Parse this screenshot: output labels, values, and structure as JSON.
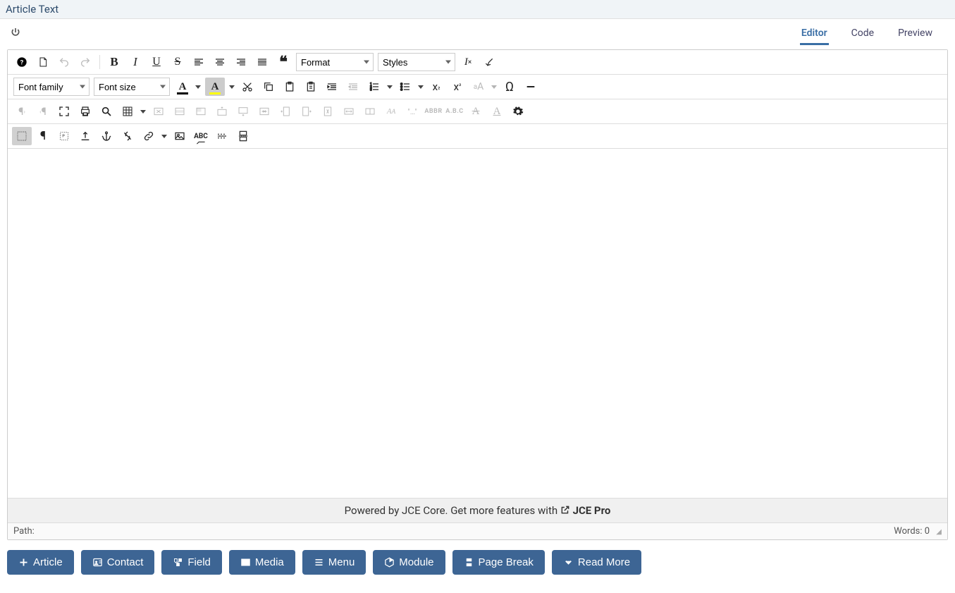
{
  "header": {
    "title": "Article Text"
  },
  "tabs": {
    "editor": "Editor",
    "code": "Code",
    "preview": "Preview",
    "active": "editor"
  },
  "toolbar": {
    "format_select": "Format",
    "styles_select": "Styles",
    "font_family": "Font family",
    "font_size": "Font size"
  },
  "promo": {
    "text_prefix": "Powered by JCE Core. Get more features with ",
    "pro_label": "JCE Pro"
  },
  "status": {
    "path_label": "Path:",
    "words_label": "Words:",
    "words_count": "0"
  },
  "buttons": {
    "article": "Article",
    "contact": "Contact",
    "field": "Field",
    "media": "Media",
    "menu": "Menu",
    "module": "Module",
    "page_break": "Page Break",
    "read_more": "Read More"
  }
}
